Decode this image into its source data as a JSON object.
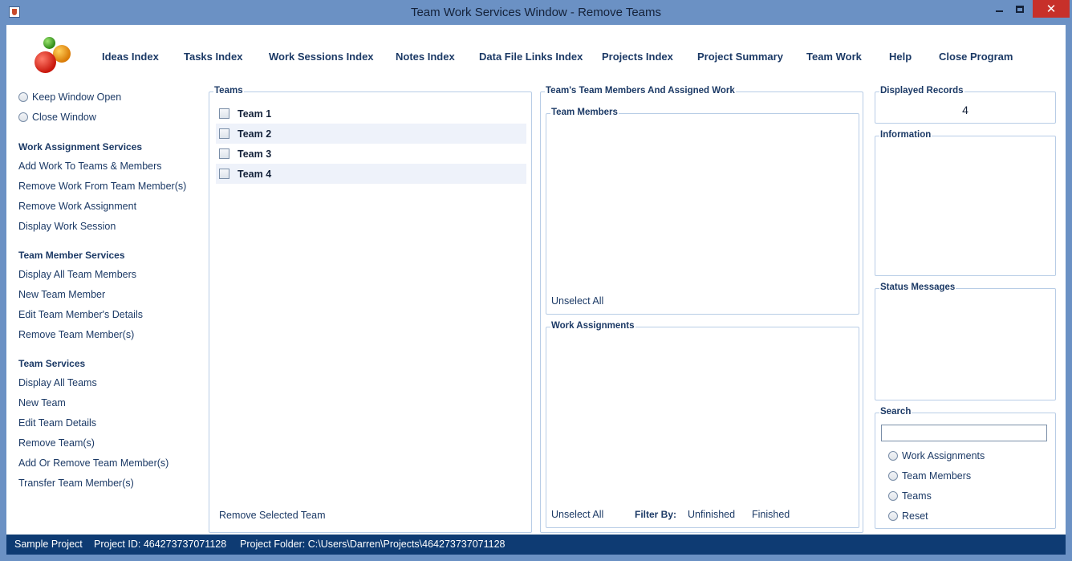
{
  "window": {
    "title": "Team Work Services Window - Remove Teams",
    "close_glyph": "✕"
  },
  "menu": [
    {
      "label": "Ideas Index"
    },
    {
      "label": "Tasks Index"
    },
    {
      "label": "Work Sessions Index"
    },
    {
      "label": "Notes Index"
    },
    {
      "label": "Data File Links Index"
    },
    {
      "label": "Projects Index"
    },
    {
      "label": "Project Summary"
    },
    {
      "label": "Team Work"
    },
    {
      "label": "Help"
    },
    {
      "label": "Close Program"
    }
  ],
  "sidebar": {
    "keep_open": "Keep Window Open",
    "close_window": "Close Window",
    "work_assignment_header": "Work Assignment Services",
    "work_assignment_items": [
      "Add Work To Teams & Members",
      "Remove Work From Team Member(s)",
      "Remove Work Assignment",
      "Display Work Session"
    ],
    "team_member_header": "Team Member Services",
    "team_member_items": [
      "Display All Team Members",
      "New Team Member",
      "Edit Team Member's Details",
      "Remove Team Member(s)"
    ],
    "team_header": "Team Services",
    "team_items": [
      "Display All Teams",
      "New Team",
      "Edit Team Details",
      "Remove Team(s)",
      "Add Or Remove Team Member(s)",
      "Transfer Team Member(s)"
    ]
  },
  "teams_panel": {
    "title": "Teams",
    "teams": [
      "Team 1",
      "Team 2",
      "Team 3",
      "Team 4"
    ],
    "remove_button": "Remove Selected Team"
  },
  "members_panel": {
    "title": "Team's Team Members And Assigned Work",
    "members_title": "Team Members",
    "members_unselect": "Unselect All",
    "work_title": "Work Assignments",
    "work_unselect": "Unselect All",
    "filter_label": "Filter By:",
    "filter_unfinished": "Unfinished",
    "filter_finished": "Finished"
  },
  "right_panel": {
    "displayed_title": "Displayed Records",
    "displayed_count": "4",
    "information_title": "Information",
    "status_title": "Status Messages",
    "search_title": "Search",
    "search_value": "",
    "search_options": [
      "Work Assignments",
      "Team Members",
      "Teams",
      "Reset"
    ]
  },
  "statusbar": {
    "project": "Sample Project",
    "project_id": "Project ID:  464273737071128",
    "project_folder": "Project Folder: C:\\Users\\Darren\\Projects\\464273737071128"
  },
  "colors": {
    "frame": "#6b91c4",
    "statusbar": "#0e3b73",
    "accent_text": "#1c3a66",
    "close_button": "#c7302a"
  }
}
